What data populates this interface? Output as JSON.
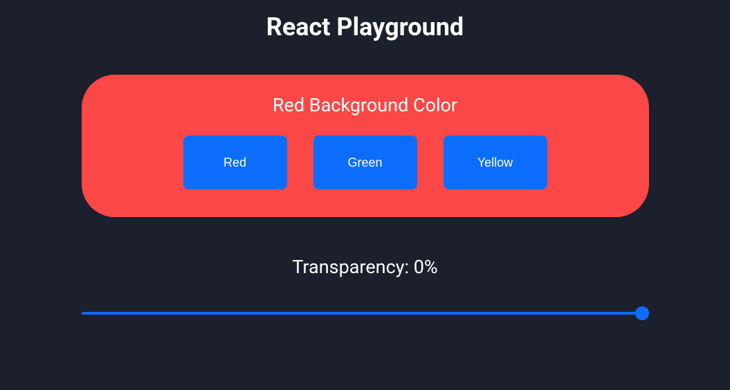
{
  "page": {
    "title": "React Playground"
  },
  "colorPanel": {
    "heading": "Red Background Color",
    "backgroundColor": "#fc4747",
    "buttons": [
      {
        "label": "Red"
      },
      {
        "label": "Green"
      },
      {
        "label": "Yellow"
      }
    ]
  },
  "transparency": {
    "labelPrefix": "Transparency: ",
    "value": 0,
    "suffix": "%",
    "min": 0,
    "max": 100,
    "sliderValue": 100
  },
  "colors": {
    "accent": "#0c6dfd",
    "pageBg": "#1b202c"
  }
}
